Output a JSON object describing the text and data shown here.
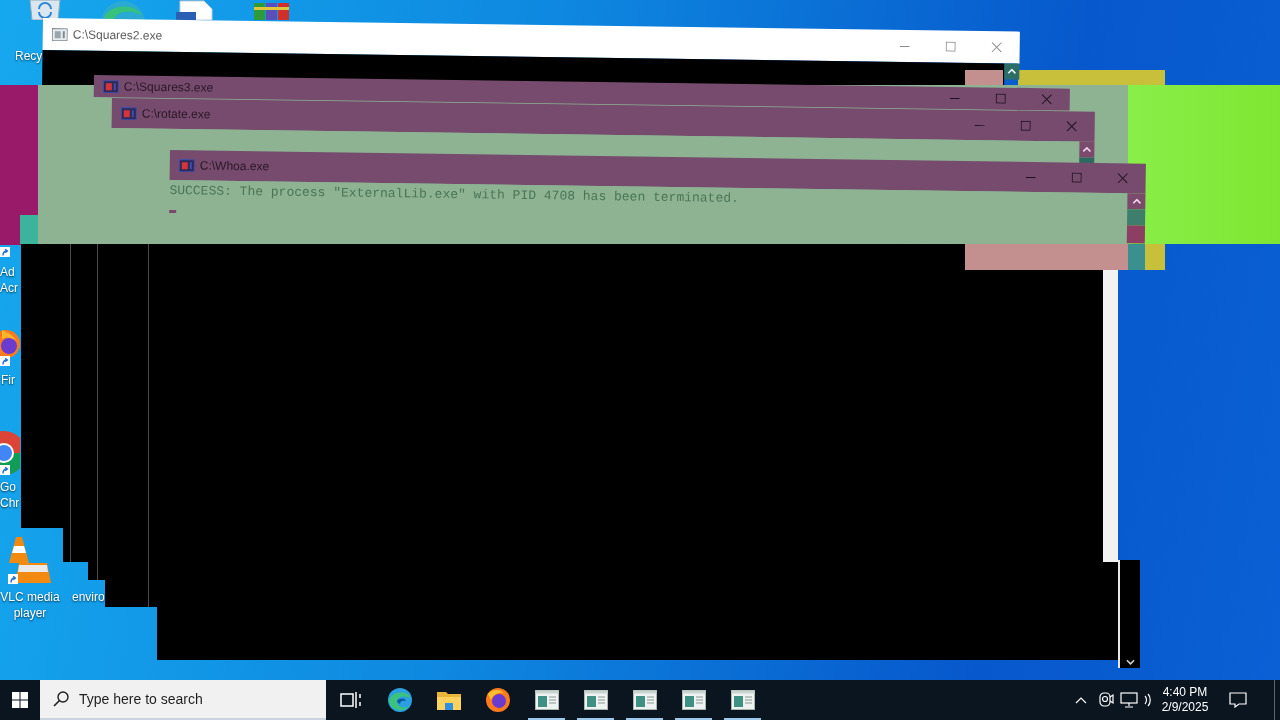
{
  "desktop_icons": [
    {
      "kind": "recycle-bin",
      "shortcut": false,
      "label_lines": [
        "Recy"
      ]
    },
    {
      "kind": "browser-swirl",
      "shortcut": false
    },
    {
      "kind": "document",
      "shortcut": false
    },
    {
      "kind": "archive",
      "shortcut": false
    },
    {
      "shortcut": true,
      "label_lines": [
        "Ad",
        "Acr"
      ]
    },
    {
      "kind": "browser-fox",
      "shortcut": true,
      "label_lines": [
        "Fir"
      ]
    },
    {
      "kind": "browser-ring",
      "shortcut": true,
      "label_lines": [
        "Go",
        "Chr"
      ]
    },
    {
      "kind": "cone",
      "shortcut": true,
      "label_lines": [
        "VLC media",
        "player"
      ]
    },
    {
      "shortcut": false,
      "label_lines": [
        "enviro"
      ]
    }
  ],
  "windows": [
    {
      "title": "C:\\Squares2.exe",
      "kind": "plain"
    },
    {
      "title": "C:\\Squares3.exe",
      "kind": "glitched"
    },
    {
      "title": "C:\\rotate.exe",
      "kind": "glitched"
    },
    {
      "title": "C:\\Whoa.exe",
      "kind": "glitched",
      "console_lines": [
        "SUCCESS: The process \"ExternalLib.exe\" with PID 4708 has been terminated."
      ]
    }
  ],
  "taskbar": {
    "search": {
      "placeholder": "Type here to search"
    },
    "buttons": [
      {
        "kind": "task-view",
        "running": false
      },
      {
        "kind": "browser-swirl",
        "running": false
      },
      {
        "kind": "folder",
        "running": false
      },
      {
        "kind": "browser-fox",
        "running": false
      },
      {
        "kind": "app-window",
        "running": true
      },
      {
        "kind": "app-window",
        "running": true
      },
      {
        "kind": "app-window",
        "running": true
      },
      {
        "kind": "app-window",
        "running": true
      },
      {
        "kind": "app-window",
        "running": true
      }
    ],
    "clock": {
      "time": "4:40 PM",
      "date": "2/9/2025"
    }
  }
}
